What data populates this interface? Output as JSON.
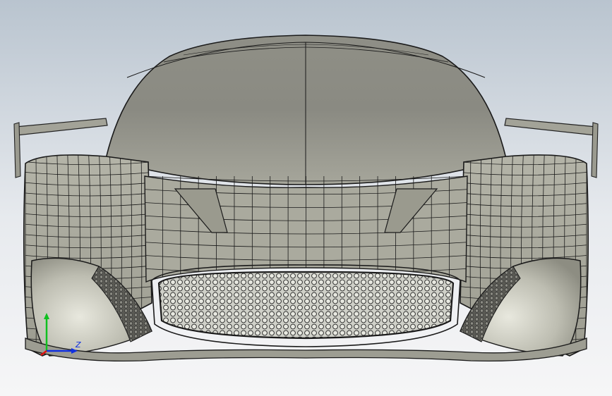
{
  "viewport": {
    "content": "cad-model-front-view",
    "background_top": "#b9c4cf",
    "background_bottom": "#f6f6f7",
    "body_color": "#a8a89c",
    "wire_color": "#1a1a1a"
  },
  "triad": {
    "x_color": "#e01010",
    "y_color": "#10c020",
    "z_color": "#1030e0",
    "z_label": "Z"
  }
}
